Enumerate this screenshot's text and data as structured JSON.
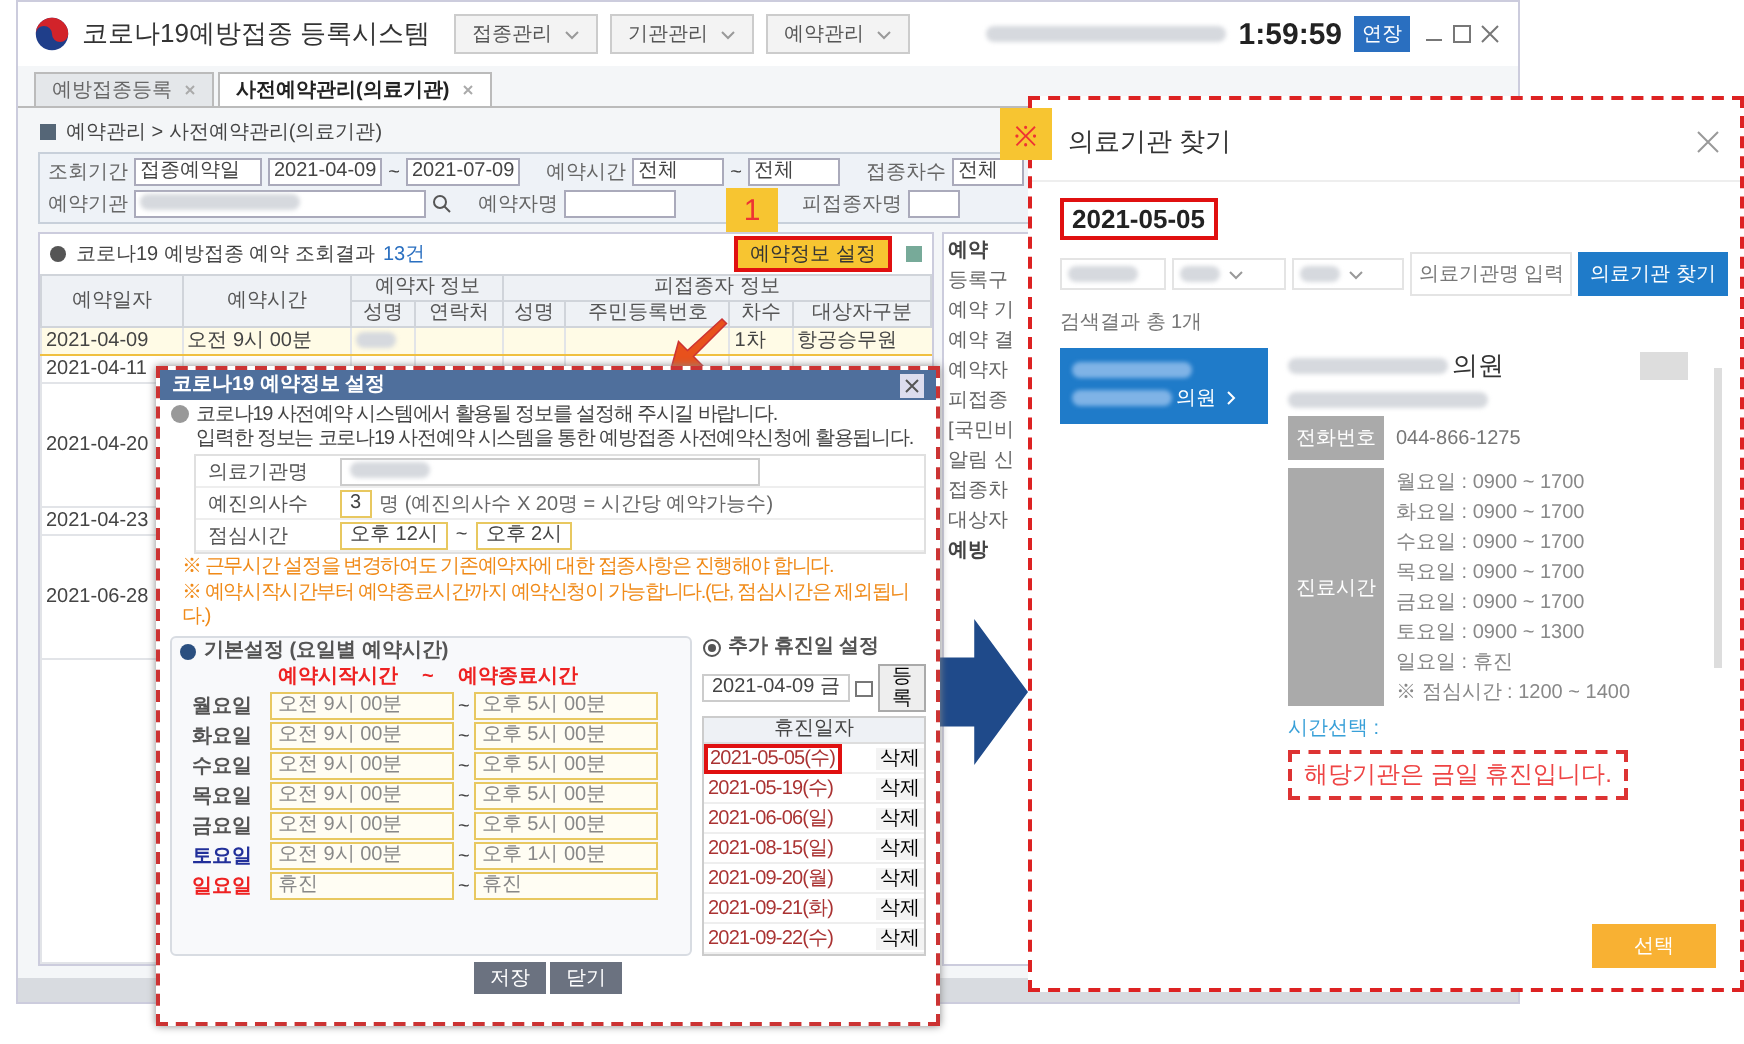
{
  "header": {
    "title": "코로나19예방접종 등록시스템",
    "menus": [
      "접종관리",
      "기관관리",
      "예약관리"
    ],
    "timer": "1:59:59",
    "extend_button": "연장"
  },
  "tabs": [
    {
      "label": "예방접종등록",
      "selected": false
    },
    {
      "label": "사전예약관리(의료기관)",
      "selected": true
    }
  ],
  "breadcrumb": "예약관리 > 사전예약관리(의료기관)",
  "filters": {
    "period_label": "조회기간",
    "period_type": "접종예약일",
    "date_from": "2021-04-09",
    "date_separator": "~",
    "date_to": "2021-07-09",
    "time_label": "예약시간",
    "time_from": "전체",
    "time_separator": "~",
    "time_to": "전체",
    "dose_label": "접종차수",
    "dose": "전체",
    "clinic_label": "예약기관",
    "booker_label": "예약자명",
    "patient_label": "피접종자명"
  },
  "results": {
    "title": "코로나19 예방접종 예약 조회결과",
    "count": "13건",
    "settings_button": "예약정보 설정",
    "step_badge": "1",
    "group_headers": [
      "예약자 정보",
      "피접종자 정보"
    ],
    "columns": [
      "예약일자",
      "예약시간",
      "성명",
      "연락처",
      "성명",
      "주민등록번호",
      "차수",
      "대상자구분"
    ],
    "rows": [
      {
        "date": "2021-04-09",
        "time": "오전 9시 00분",
        "dose": "1차",
        "target": "항공승무원",
        "selected": true
      },
      {
        "date": "2021-04-11",
        "selected": false
      },
      {
        "date": "2021-04-20",
        "selected": false
      },
      {
        "date": "2021-04-23",
        "selected": false
      },
      {
        "date": "2021-06-28",
        "selected": false
      }
    ]
  },
  "side_panel": {
    "title": "예약",
    "labels": [
      "등록구",
      "예약 기",
      "예약 결",
      "예약자",
      "피접종",
      "[국민비",
      "알림 신",
      "접종차",
      "대상자"
    ],
    "section": "예방"
  },
  "settings_dialog": {
    "title": "코로나19 예약정보 설정",
    "info": [
      "코로나19 사전예약 시스템에서 활용될 정보를 설정해 주시길 바랍니다.",
      "입력한 정보는 코로나19 사전예약 시스템을 통한 예방접종 사전예약신청에 활용됩니다."
    ],
    "clinic_label": "의료기관명",
    "doctors_label": "예진의사수",
    "doctors": "3",
    "doctors_note": "명 (예진의사수 X 20명 = 시간당 예약가능수)",
    "lunch_label": "점심시간",
    "lunch_from": "오후 12시",
    "lunch_separator": "~",
    "lunch_to": "오후 2시",
    "notes": [
      "※ 근무시간 설정을 변경하여도 기존예약자에 대한 접종사항은 진행해야 합니다.",
      "※ 예약시작시간부터 예약종료시간까지 예약신청이 가능합니다.(단, 점심시간은 제외됩니다.)"
    ],
    "basic_title": "기본설정 (요일별 예약시간)",
    "start_header": "예약시작시간",
    "tilde": "~",
    "end_header": "예약종료시간",
    "days": [
      {
        "day": "월요일",
        "kind": "weekday",
        "start": "오전 9시 00분",
        "separator": "~",
        "end": "오후 5시 00분"
      },
      {
        "day": "화요일",
        "kind": "weekday",
        "start": "오전 9시 00분",
        "separator": "~",
        "end": "오후 5시 00분"
      },
      {
        "day": "수요일",
        "kind": "weekday",
        "start": "오전 9시 00분",
        "separator": "~",
        "end": "오후 5시 00분"
      },
      {
        "day": "목요일",
        "kind": "weekday",
        "start": "오전 9시 00분",
        "separator": "~",
        "end": "오후 5시 00분"
      },
      {
        "day": "금요일",
        "kind": "weekday",
        "start": "오전 9시 00분",
        "separator": "~",
        "end": "오후 5시 00분"
      },
      {
        "day": "토요일",
        "kind": "saturday",
        "start": "오전 9시 00분",
        "separator": "~",
        "end": "오후 1시 00분"
      },
      {
        "day": "일요일",
        "kind": "sunday",
        "start": "휴진",
        "separator": "~",
        "end": "휴진"
      }
    ],
    "holiday_title": "추가 휴진일 설정",
    "holiday_input": "2021-04-09 금",
    "register_button": "등록",
    "holiday_header": "휴진일자",
    "holidays": [
      {
        "date": "2021-05-05(수)",
        "highlighted": true,
        "delete": "삭제"
      },
      {
        "date": "2021-05-19(수)",
        "highlighted": false,
        "delete": "삭제"
      },
      {
        "date": "2021-06-06(일)",
        "highlighted": false,
        "delete": "삭제"
      },
      {
        "date": "2021-08-15(일)",
        "highlighted": false,
        "delete": "삭제"
      },
      {
        "date": "2021-09-20(월)",
        "highlighted": false,
        "delete": "삭제"
      },
      {
        "date": "2021-09-21(화)",
        "highlighted": false,
        "delete": "삭제"
      },
      {
        "date": "2021-09-22(수)",
        "highlighted": false,
        "delete": "삭제"
      }
    ],
    "buttons": [
      "저장",
      "닫기"
    ]
  },
  "finder": {
    "badge": "※",
    "title": "의료기관 찾기",
    "date": "2021-05-05",
    "name_placeholder": "의료기관명 입력",
    "search_button": "의료기관 찾기",
    "result_count": "검색결과 총 1개",
    "result_suffix": "의원",
    "detail_suffix": "의원",
    "phone_label": "전화번호",
    "phone": "044-866-1275",
    "hours_label": "진료시간",
    "hours": [
      "월요일 : 0900 ~ 1700",
      "화요일 : 0900 ~ 1700",
      "수요일 : 0900 ~ 1700",
      "목요일 : 0900 ~ 1700",
      "금요일 : 0900 ~ 1700",
      "토요일 : 0900 ~ 1300",
      "일요일 : 휴진",
      "※ 점심시간 : 1200 ~ 1400"
    ],
    "time_select_label": "시간선택 :",
    "closed_notice": "해당기관은 금일 휴진입니다.",
    "select_button": "선택"
  }
}
